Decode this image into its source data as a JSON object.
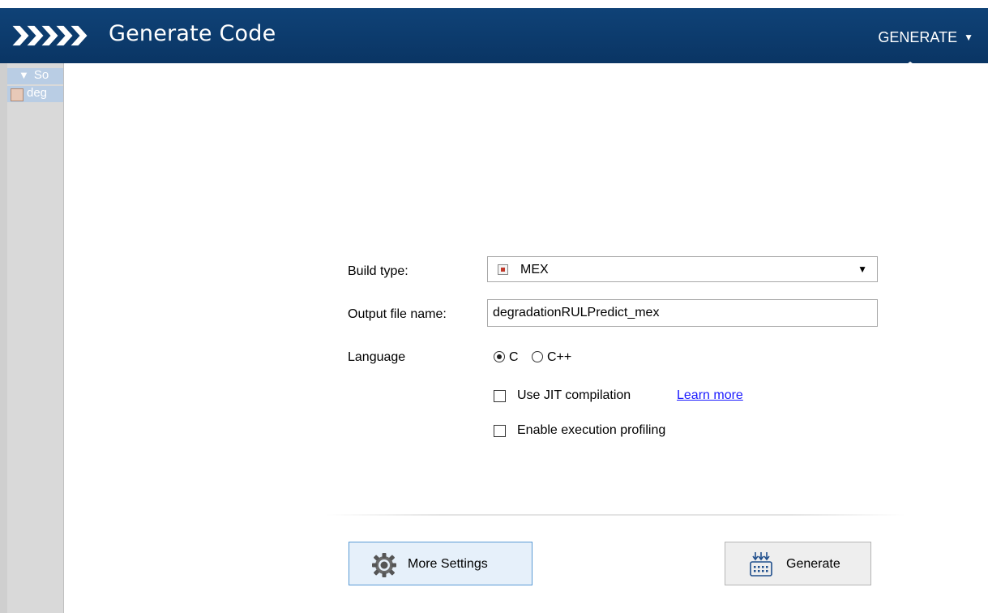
{
  "header": {
    "title": "Generate Code",
    "menu_label": "GENERATE",
    "background": "#0c3a6b"
  },
  "left_panel": {
    "source_label": "So",
    "file_label": "deg"
  },
  "form": {
    "build_type_label": "Build type:",
    "build_type_value": "MEX",
    "output_label": "Output file name:",
    "output_value": "degradationRULPredict_mex",
    "language_label": "Language",
    "language_options": [
      "C",
      "C++"
    ],
    "language_selected": "C",
    "jit_label": "Use JIT compilation",
    "jit_checked": false,
    "learn_more": "Learn more",
    "profiling_label": "Enable execution profiling",
    "profiling_checked": false
  },
  "buttons": {
    "more_settings": "More Settings",
    "generate": "Generate"
  }
}
